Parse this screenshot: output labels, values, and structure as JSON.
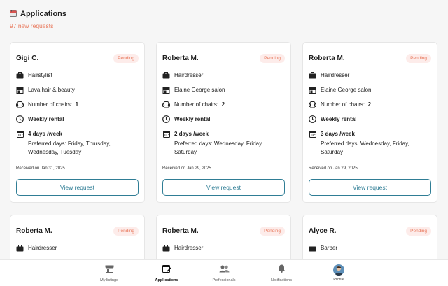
{
  "header": {
    "title": "Applications",
    "new_requests": "97 new requests"
  },
  "cards": [
    {
      "name": "Gigi C.",
      "status": "Pending",
      "role": "Hairstylist",
      "salon": "Lava hair & beauty",
      "chairs_label": "Number of chairs:",
      "chairs": "1",
      "rental": "Weekly rental",
      "days": "4 days /week",
      "preferred": "Preferred days: Friday, Thursday, Wednesday, Tuesday",
      "received": "Received on Jan 31, 2025",
      "button": "View request"
    },
    {
      "name": "Roberta M.",
      "status": "Pending",
      "role": "Hairdresser",
      "salon": "Elaine George salon",
      "chairs_label": "Number of chairs:",
      "chairs": "2",
      "rental": "Weekly rental",
      "days": "2 days /week",
      "preferred": "Preferred days: Wednesday, Friday, Saturday",
      "received": "Received on Jan 29, 2025",
      "button": "View request"
    },
    {
      "name": "Roberta M.",
      "status": "Pending",
      "role": "Hairdresser",
      "salon": "Elaine George salon",
      "chairs_label": "Number of chairs:",
      "chairs": "2",
      "rental": "Weekly rental",
      "days": "3 days /week",
      "preferred": "Preferred days: Wednesday, Friday, Saturday",
      "received": "Received on Jan 29, 2025",
      "button": "View request"
    },
    {
      "name": "Roberta M.",
      "status": "Pending",
      "role": "Hairdresser"
    },
    {
      "name": "Roberta M.",
      "status": "Pending",
      "role": "Hairdresser"
    },
    {
      "name": "Alyce R.",
      "status": "Pending",
      "role": "Barber"
    }
  ],
  "nav": [
    {
      "label": "My listings",
      "icon": "store-icon"
    },
    {
      "label": "Applications",
      "icon": "calendar-edit-icon",
      "active": true
    },
    {
      "label": "Professionals",
      "icon": "people-icon"
    },
    {
      "label": "Notifications",
      "icon": "bell-icon"
    },
    {
      "label": "Profile",
      "icon": "avatar"
    }
  ],
  "colors": {
    "accent": "#2f7d95",
    "pending": "#e8775a",
    "pending_bg": "#fdecea"
  }
}
